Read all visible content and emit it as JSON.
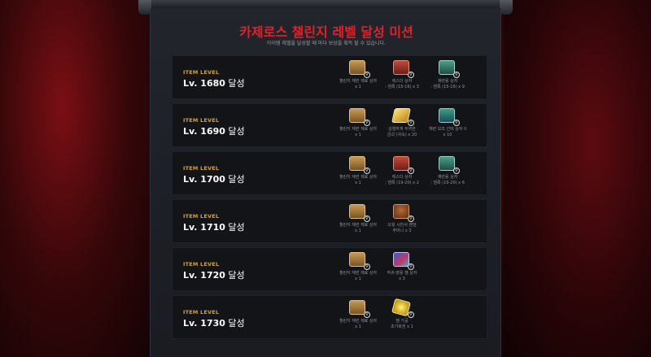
{
  "header": {
    "title": "카제로스 챌린지 레벨 달성 미션",
    "subtitle": "아이템 레벨을 달성할 때 마다 보상을 획득 할 수 있습니다."
  },
  "rows": [
    {
      "tag": "ITEM LEVEL",
      "level": "Lv. 1680",
      "suffix": " 달성",
      "rewards": [
        {
          "icon": "chest-gold-icon",
          "line1": "챌린지 재련 재료 상자",
          "line2": "x 1"
        },
        {
          "icon": "chest-red-icon",
          "line1": "에스더 상자",
          "line2": ": 엠록 (15-16) x 3"
        },
        {
          "icon": "chest-green-icon",
          "line1": "재련용 상자",
          "line2": ": 엠록 (15-16) x 9"
        }
      ]
    },
    {
      "tag": "ITEM LEVEL",
      "level": "Lv. 1690",
      "suffix": " 달성",
      "rewards": [
        {
          "icon": "chest-gold-icon",
          "line1": "챌린지 재련 재료 상자",
          "line2": "x 1"
        },
        {
          "icon": "gold-bar-icon",
          "line1": "강렬하게 두꺼한",
          "line2": "금괴 (귀속) x 20"
        },
        {
          "icon": "chest-green-blue-icon",
          "line1": "재련 보조 선택 상자 II",
          "line2": "x 10"
        }
      ]
    },
    {
      "tag": "ITEM LEVEL",
      "level": "Lv. 1700",
      "suffix": " 달성",
      "rewards": [
        {
          "icon": "chest-gold-icon",
          "line1": "챌린지 재련 재료 상자",
          "line2": "x 1"
        },
        {
          "icon": "chest-red-icon",
          "line1": "에스더 상자",
          "line2": ": 엠록 (19-20) x 2"
        },
        {
          "icon": "chest-green-icon",
          "line1": "재련용 상자",
          "line2": ": 엠록 (19-20) x 6"
        }
      ]
    },
    {
      "tag": "ITEM LEVEL",
      "level": "Lv. 1710",
      "suffix": " 달성",
      "rewards": [
        {
          "icon": "chest-gold-icon",
          "line1": "챌린지 재련 재료 상자",
          "line2": "x 1"
        },
        {
          "icon": "pouch-icon",
          "line1": "오월 시반서 랜덤",
          "line2": "주머니 x 3"
        }
      ]
    },
    {
      "tag": "ITEM LEVEL",
      "level": "Lv. 1720",
      "suffix": " 달성",
      "rewards": [
        {
          "icon": "chest-gold-icon",
          "line1": "챌린지 재련 재료 상자",
          "line2": "x 1"
        },
        {
          "icon": "gem-box-icon",
          "line1": "작귀·영웅 젬 상자",
          "line2": "x 3"
        }
      ]
    },
    {
      "tag": "ITEM LEVEL",
      "level": "Lv. 1730",
      "suffix": " 달성",
      "rewards": [
        {
          "icon": "chest-gold-icon",
          "line1": "챌린지 재련 재료 상자",
          "line2": "x 1"
        },
        {
          "icon": "gem-gold-icon",
          "line1": "젬 가공",
          "line2": "초기화권 x 1"
        }
      ]
    }
  ],
  "colors": {
    "title": "#e0202a",
    "level_tag": "#d9a21b",
    "panel_bg": "#1e2127",
    "row_bg": "#121418"
  }
}
